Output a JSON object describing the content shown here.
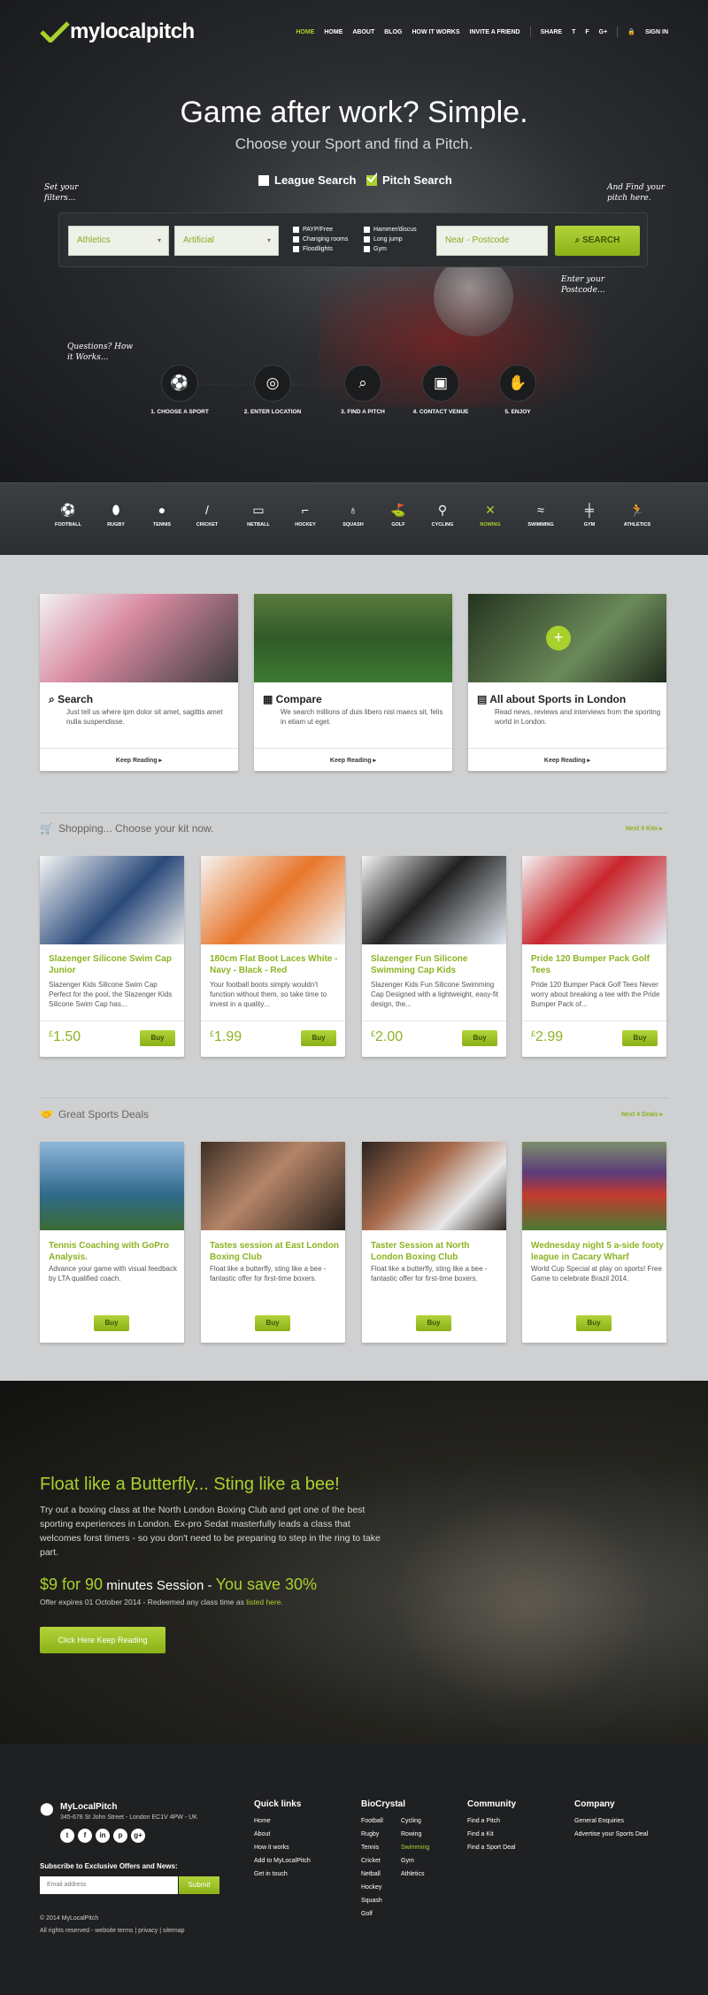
{
  "header": {
    "logo": "mylocalpitch",
    "nav": [
      "HOME",
      "ABOUT",
      "BLOG",
      "HOW IT WORKS",
      "INVITE A FRIEND"
    ],
    "share": "SHARE",
    "sign_in": "SIGN IN"
  },
  "hero": {
    "title": "Game after work? Simple.",
    "subtitle": "Choose your Sport and find a Pitch.",
    "league_search": "League Search",
    "pitch_search": "Pitch Search",
    "note_filters": "Set your filters...",
    "note_find": "And Find your pitch here.",
    "note_postcode": "Enter your Postcode...",
    "note_questions": "Questions? How it Works..."
  },
  "search": {
    "sport_value": "Athletics",
    "surface_value": "Artificial",
    "filters": [
      "PAYP/Free",
      "Hammer/discus",
      "Changing rooms",
      "Long jump",
      "Floodlights",
      "Gym"
    ],
    "postcode_placeholder": "Near - Postcode",
    "button": "SEARCH"
  },
  "steps": [
    "1. CHOOSE A SPORT",
    "2. ENTER LOCATION",
    "3. FIND A PITCH",
    "4. CONTACT VENUE",
    "5. ENJOY"
  ],
  "sports": [
    "FOOTBALL",
    "RUGBY",
    "TENNIS",
    "CRICKET",
    "NETBALL",
    "HOCKEY",
    "SQUASH",
    "GOLF",
    "CYCLING",
    "ROWING",
    "SWIMMING",
    "GYM",
    "ATHLETICS"
  ],
  "features": [
    {
      "title": "Search",
      "desc": "Just tell us where ipm dolor sit amet, sagittis amet nulla suspendisse.",
      "link": "Keep Reading"
    },
    {
      "title": "Compare",
      "desc": "We search millions of duis libero nisl maecs sit, felis in etiam ut eget.",
      "link": "Keep Reading"
    },
    {
      "title": "All about Sports in London",
      "desc": "Read news, reviews and interviews from the sporting world in London.",
      "link": "Keep Reading"
    }
  ],
  "shopping": {
    "heading": "Shopping... Choose your kit now.",
    "next": "Next 4 Kits",
    "items": [
      {
        "title": "Slazenger Silicone Swim Cap Junior",
        "desc": "Slazenger Kids Silicone Swim Cap Perfect for the pool, the Slazenger Kids Silicone Swim Cap has...",
        "price": "1.50",
        "buy": "Buy"
      },
      {
        "title": "180cm Flat Boot Laces White - Navy - Black - Red",
        "desc": "Your football boots simply wouldn't function without them, so take time to invest in a quality...",
        "price": "1.99",
        "buy": "Buy"
      },
      {
        "title": "Slazenger Fun Silicone Swimming Cap Kids",
        "desc": "Slazenger Kids Fun Silicone Swimming Cap Designed with a lightweight, easy-fit design, the...",
        "price": "2.00",
        "buy": "Buy"
      },
      {
        "title": "Pride 120 Bumper Pack Golf Tees",
        "desc": "Pride 120 Bumper Pack Golf Tees Never worry about breaking a tee with the Pride Bumper Pack of...",
        "price": "2.99",
        "buy": "Buy"
      }
    ]
  },
  "deals": {
    "heading": "Great Sports Deals",
    "next": "Next 4 Deals",
    "items": [
      {
        "title": "Tennis Coaching with GoPro Analysis.",
        "desc": "Advance your game with visual feedback by LTA qualified coach.",
        "buy": "Buy"
      },
      {
        "title": "Tastes session at East London Boxing Club",
        "desc": "Float like a butterfly, sting like a bee - fantastic offer for first-time boxers.",
        "buy": "Buy"
      },
      {
        "title": "Taster Session at North London Boxing Club",
        "desc": "Float like a butterfly, sting like a bee - fantastic offer for first-time boxers.",
        "buy": "Buy"
      },
      {
        "title": "Wednesday night 5 a-side footy league in Cacary Wharf",
        "desc": "World Cup Special at play on sports! Free Game to celebrate Brazil 2014.",
        "buy": "Buy"
      }
    ]
  },
  "promo": {
    "title": "Float like a Butterfly... Sting like a bee!",
    "body": "Try out a boxing class at the North London Boxing Club and get one of the best sporting experiences in London. Ex-pro Sedat masterfully leads a class that welcomes forst timers - so you don't need to be preparing to step in the ring to take part.",
    "offer_price": "$9 for 90",
    "offer_mid": " minutes Session - ",
    "offer_save": "You save 30%",
    "expiry": "Offer expires 01 October 2014 - Redeemed any class time as ",
    "expiry_link": "listed here.",
    "button": "Click Here Keep Reading"
  },
  "footer": {
    "brand": "MyLocalPitch",
    "address": "345-678 St John Street - London EC1V 4PW - UK",
    "subscribe_label": "Subscribe to Exclusive Offers and News:",
    "email_placeholder": "Email address",
    "submit": "Submit",
    "copyright": "© 2014 MyLocalPitch",
    "rights": "All rights reserved - website terms | privacy | sitemap",
    "quick_links_title": "Quick links",
    "quick_links": [
      "Home",
      "About",
      "How it works",
      "Add to MyLocalPitch",
      "Get in touch"
    ],
    "biocrystal_title": "BioCrystal",
    "biocrystal_col1": [
      "Football",
      "Rugby",
      "Tennis",
      "Cricket",
      "Netball",
      "Hockey",
      "Squash",
      "Golf"
    ],
    "biocrystal_col2": [
      "Cycling",
      "Rowing",
      "Swimming",
      "Gym",
      "Athletics"
    ],
    "community_title": "Community",
    "community": [
      "Find a Pitch",
      "Find a Kit",
      "Find a Sport Deal"
    ],
    "company_title": "Company",
    "company": [
      "General Enquiries",
      "Advertise your Sports Deal"
    ]
  },
  "colors": {
    "accent": "#a8d12d",
    "accent_text": "#8cb323",
    "dark": "#1f2022"
  }
}
